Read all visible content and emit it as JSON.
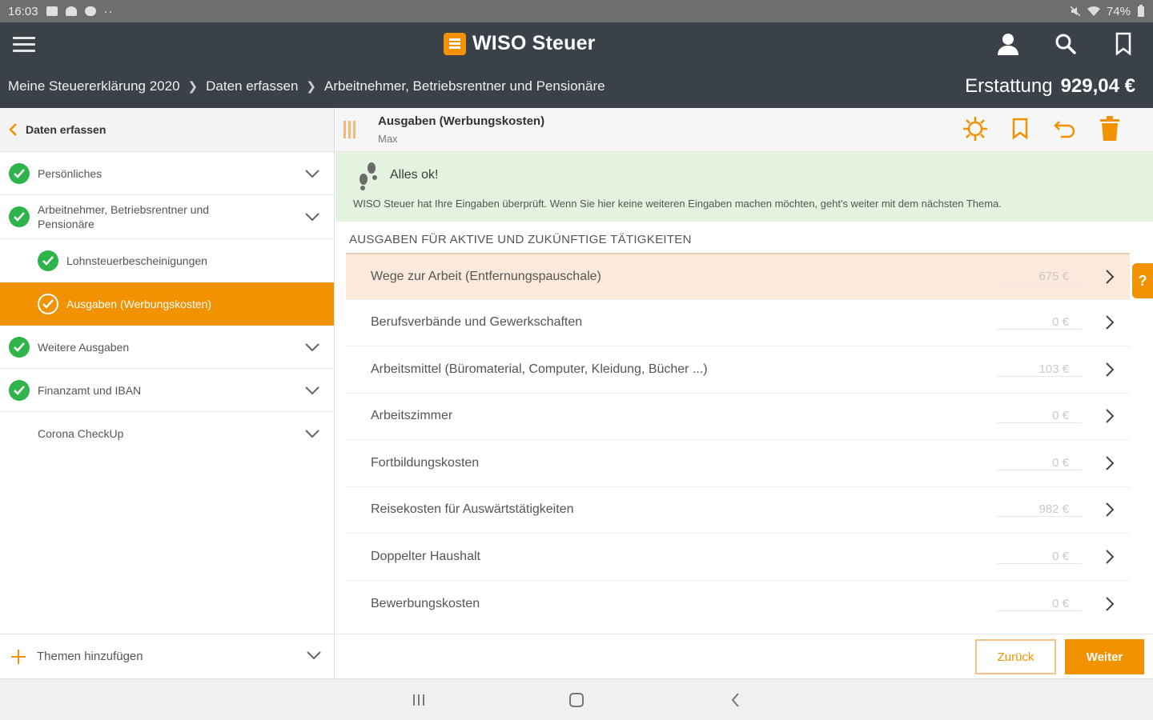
{
  "statusbar": {
    "time": "16:03",
    "dots": "··",
    "battery": "74%"
  },
  "header": {
    "brand": "WISO Steuer",
    "breadcrumbs": [
      "Meine Steuererklärung 2020",
      "Daten erfassen",
      "Arbeitnehmer, Betriebsrentner und Pensionäre"
    ],
    "refund_label": "Erstattung",
    "refund_amount": "929,04 €"
  },
  "sidebar": {
    "back_label": "Daten erfassen",
    "items": [
      {
        "label": "Persönliches"
      },
      {
        "label": "Arbeitnehmer, Betriebsrentner und Pensionäre"
      },
      {
        "label": "Lohnsteuerbescheinigungen"
      },
      {
        "label": "Ausgaben (Werbungskosten)"
      },
      {
        "label": "Weitere Ausgaben"
      },
      {
        "label": "Finanzamt und IBAN"
      },
      {
        "label": "Corona CheckUp"
      }
    ],
    "add_topics": "Themen hinzufügen"
  },
  "main": {
    "title": "Ausgaben (Werbungskosten)",
    "subtitle": "Max",
    "ok_title": "Alles ok!",
    "ok_text": "WISO Steuer hat Ihre Eingaben überprüft. Wenn Sie hier keine weiteren Eingaben machen möchten, geht's weiter mit dem nächsten Thema.",
    "section_title": "AUSGABEN FÜR AKTIVE UND ZUKÜNFTIGE TÄTIGKEITEN",
    "rows": [
      {
        "label": "Wege zur Arbeit (Entfernungspauschale)",
        "value": "675 €"
      },
      {
        "label": "Berufsverbände und Gewerkschaften",
        "value": "0 €"
      },
      {
        "label": "Arbeitsmittel (Büromaterial, Computer, Kleidung, Bücher ...)",
        "value": "103 €"
      },
      {
        "label": "Arbeitszimmer",
        "value": "0 €"
      },
      {
        "label": "Fortbildungskosten",
        "value": "0 €"
      },
      {
        "label": "Reisekosten für Auswärtstätigkeiten",
        "value": "982 €"
      },
      {
        "label": "Doppelter Haushalt",
        "value": "0 €"
      },
      {
        "label": "Bewerbungskosten",
        "value": "0 €"
      }
    ],
    "help_label": "?",
    "back_button": "Zurück",
    "next_button": "Weiter"
  },
  "colors": {
    "accent": "#f39200",
    "header": "#3a4149",
    "success": "#2eb44a",
    "ok_bg": "#e3f3df"
  }
}
